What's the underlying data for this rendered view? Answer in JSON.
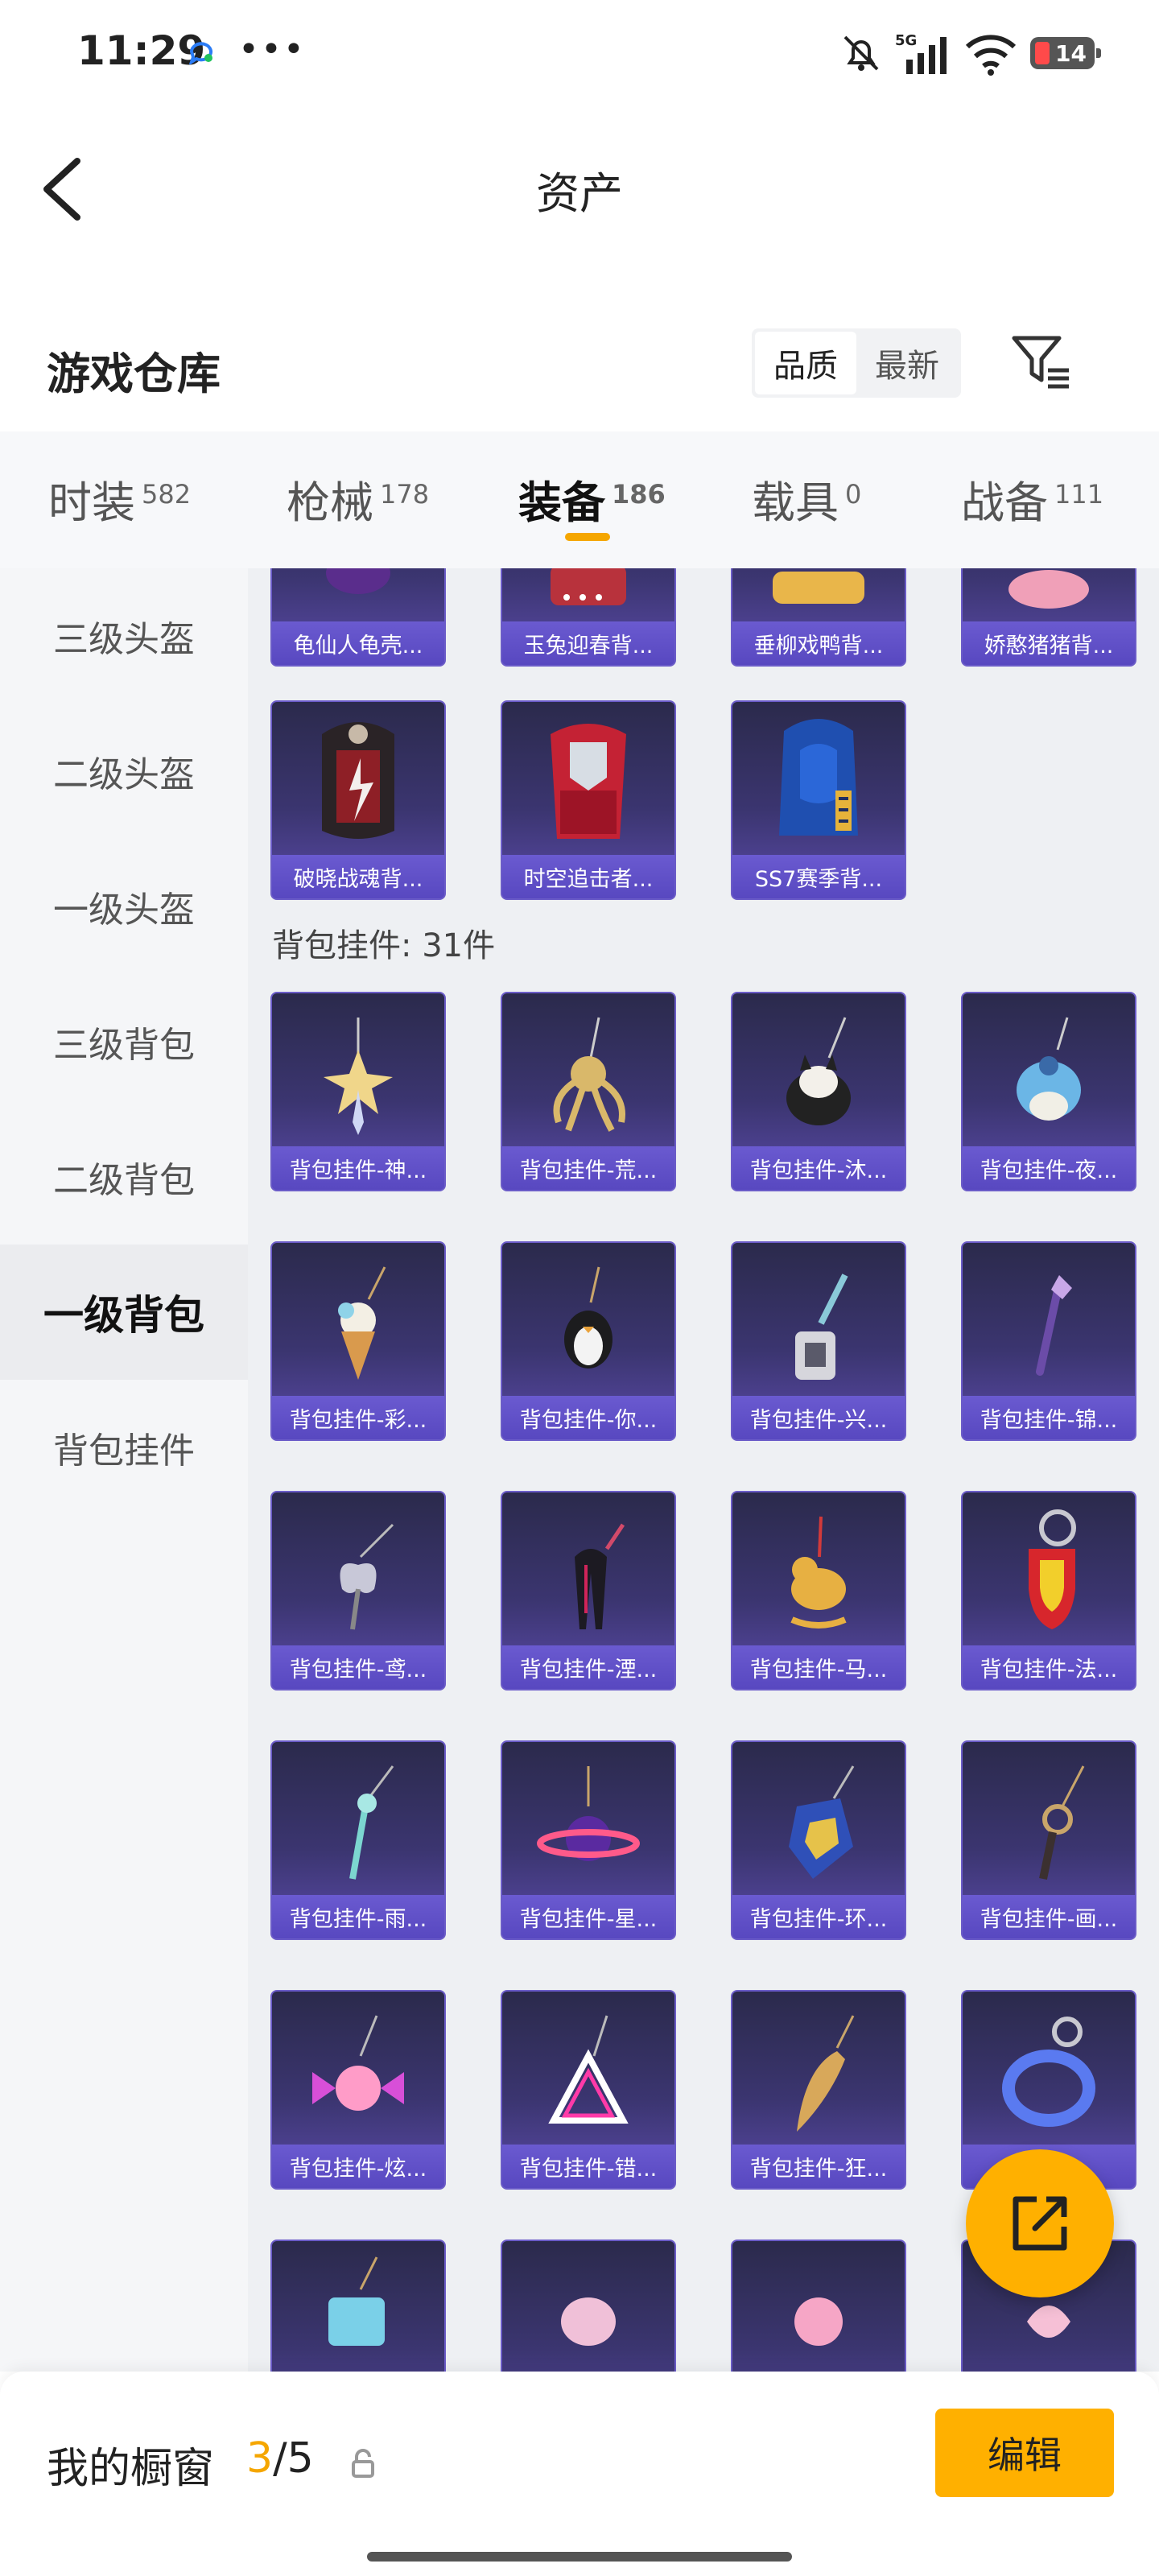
{
  "status": {
    "time": "11:29",
    "dots": "•••",
    "network": "5G",
    "battery": "14"
  },
  "header": {
    "title": "资产"
  },
  "warehouse": {
    "title": "游戏仓库",
    "sort_options": [
      "品质",
      "最新"
    ],
    "active_sort": "品质"
  },
  "category_tabs": [
    {
      "label": "时装",
      "count": "582"
    },
    {
      "label": "枪械",
      "count": "178"
    },
    {
      "label": "装备",
      "count": "186",
      "active": true
    },
    {
      "label": "载具",
      "count": "0"
    },
    {
      "label": "战备",
      "count": "111"
    }
  ],
  "sidebar": {
    "items": [
      {
        "label": "三级头盔"
      },
      {
        "label": "二级头盔"
      },
      {
        "label": "一级头盔"
      },
      {
        "label": "三级背包"
      },
      {
        "label": "二级背包"
      },
      {
        "label": "一级背包",
        "active": true
      },
      {
        "label": "背包挂件"
      }
    ]
  },
  "content": {
    "top_row": [
      "龟仙人龟壳...",
      "玉兔迎春背...",
      "垂柳戏鸭背...",
      "娇憨猪猪背..."
    ],
    "backpack_row": [
      "破晓战魂背...",
      "时空追击者...",
      "SS7赛季背..."
    ],
    "section_title": "背包挂件: 31件",
    "charms": [
      "背包挂件-神...",
      "背包挂件-荒...",
      "背包挂件-沐...",
      "背包挂件-夜...",
      "背包挂件-彩...",
      "背包挂件-你...",
      "背包挂件-兴...",
      "背包挂件-锦...",
      "背包挂件-鸢...",
      "背包挂件-湮...",
      "背包挂件-马...",
      "背包挂件-法...",
      "背包挂件-雨...",
      "背包挂件-星...",
      "背包挂件-环...",
      "背包挂件-画...",
      "背包挂件-炫...",
      "背包挂件-错...",
      "背包挂件-狂...",
      ""
    ]
  },
  "bottom_bar": {
    "label": "我的橱窗",
    "current": "3",
    "total": "/5",
    "edit_label": "编辑"
  },
  "colors": {
    "accent": "#ffb000",
    "card_label": "#5848c0"
  }
}
